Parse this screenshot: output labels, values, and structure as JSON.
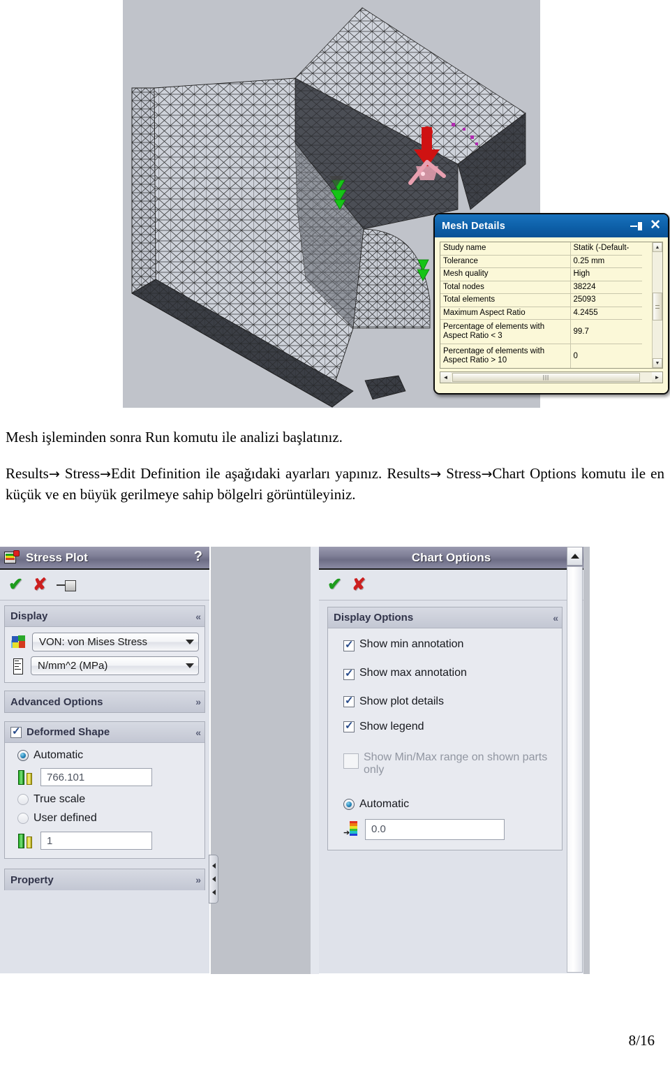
{
  "document": {
    "page_number": "8/16",
    "paragraph_1": "Mesh işleminden sonra Run komutu ile analizi başlatınız.",
    "paragraph_2_a": "Results",
    "paragraph_2_b": " Stress",
    "paragraph_2_c": "Edit Definition ile aşağıdaki ayarları yapınız. Results",
    "paragraph_2_d": " Stress",
    "paragraph_2_e": "Chart Options komutu ile en küçük ve en büyük gerilmeye sahip bölgelri görüntüleyiniz.",
    "arrow_glyph": "→"
  },
  "mesh_details": {
    "title": "Mesh Details",
    "pin_icon": "pin-icon",
    "close_icon": "close-icon",
    "rows": [
      {
        "key": "Study name",
        "value": "Statik (-Default-"
      },
      {
        "key": "Tolerance",
        "value": "0.25 mm"
      },
      {
        "key": "Mesh quality",
        "value": "High"
      },
      {
        "key": "Total nodes",
        "value": "38224"
      },
      {
        "key": "Total elements",
        "value": "25093"
      },
      {
        "key": "Maximum Aspect Ratio",
        "value": "4.2455"
      },
      {
        "key": "Percentage of elements with Aspect Ratio < 3",
        "value": "99.7"
      },
      {
        "key": "Percentage of elements with Aspect Ratio > 10",
        "value": "0"
      }
    ],
    "scroll_up": "▲",
    "scroll_down": "▼",
    "scroll_left": "◄",
    "scroll_right": "►",
    "hthumb_grip": "|||"
  },
  "stress_plot": {
    "title": "Stress Plot",
    "help_label": "?",
    "toolbar": {
      "ok_label": "✔",
      "cancel_label": "✘",
      "pin_label": "pushpin-icon"
    },
    "display_group": {
      "header": "Display",
      "collapse_glyph": "«",
      "component_value": "VON: von Mises Stress",
      "units_value": "N/mm^2 (MPa)"
    },
    "advanced_options": {
      "header": "Advanced Options",
      "expand_glyph": "»"
    },
    "deformed_shape": {
      "header": "Deformed Shape",
      "collapse_glyph": "«",
      "checked": true,
      "automatic_label": "Automatic",
      "automatic_value": "766.101",
      "true_scale_label": "True scale",
      "user_defined_label": "User defined",
      "user_defined_value": "1"
    },
    "property": {
      "header": "Property",
      "expand_glyph": "»"
    }
  },
  "chart_options": {
    "title": "Chart Options",
    "help_label": "?",
    "toolbar": {
      "ok_label": "✔",
      "cancel_label": "✘"
    },
    "display_options": {
      "header": "Display Options",
      "collapse_glyph": "«",
      "items": [
        {
          "label": "Show min annotation",
          "checked": true,
          "disabled": false
        },
        {
          "label": "Show max annotation",
          "checked": true,
          "disabled": false
        },
        {
          "label": "Show plot details",
          "checked": true,
          "disabled": false
        },
        {
          "label": "Show legend",
          "checked": true,
          "disabled": false
        },
        {
          "label": "Show Min/Max range on shown parts only",
          "checked": false,
          "disabled": true
        }
      ],
      "automatic_label": "Automatic",
      "automatic_selected": true,
      "position_value": "0.0"
    },
    "scroll_up_glyph": "▲"
  },
  "colors": {
    "title_blue": "#0d5fa8",
    "panel_title_gray": "#7f7f96",
    "panel_bg": "#dfe2ea",
    "viewport_gray": "#bfc2c9",
    "mesh_detail_bg": "#fbf8d8",
    "ok_green": "#1d9b1d",
    "cancel_red": "#cc1f1f"
  }
}
